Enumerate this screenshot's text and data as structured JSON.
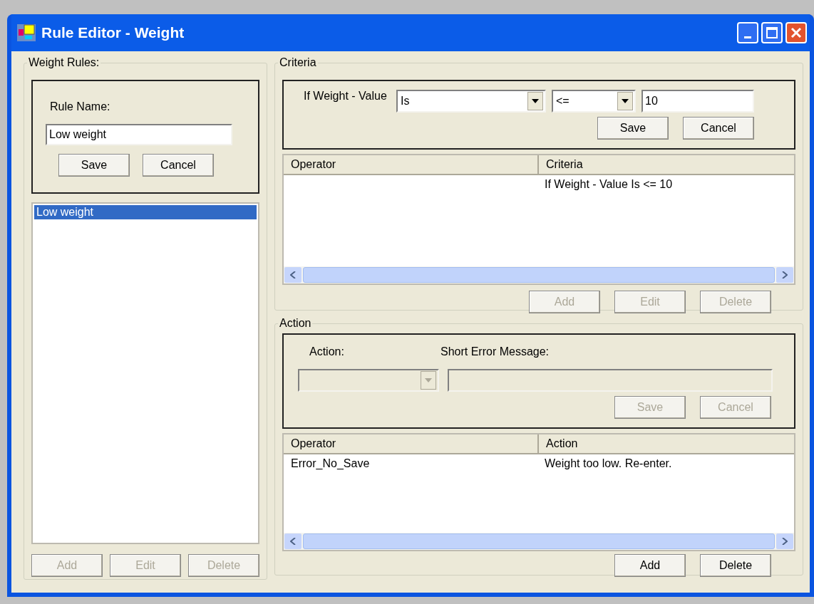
{
  "window": {
    "title": "Rule Editor - Weight"
  },
  "weight_rules": {
    "legend": "Weight Rules:",
    "rule_name_label": "Rule Name:",
    "rule_name_value": "Low weight",
    "form_buttons": [
      {
        "label": "Save",
        "disabled": false
      },
      {
        "label": "Cancel",
        "disabled": false
      }
    ],
    "list": [
      {
        "label": "Low weight",
        "selected": true
      }
    ],
    "list_buttons": [
      {
        "label": "Add",
        "disabled": true
      },
      {
        "label": "Edit",
        "disabled": true
      },
      {
        "label": "Delete",
        "disabled": true
      }
    ]
  },
  "criteria": {
    "legend": "Criteria",
    "field_label": "If Weight - Value",
    "condition_dropdown": {
      "value": "Is",
      "disabled": false
    },
    "operator_dropdown": {
      "value": "<=",
      "disabled": false
    },
    "value_field": {
      "value": "10",
      "disabled": false
    },
    "form_buttons": [
      {
        "label": "Save",
        "disabled": false
      },
      {
        "label": "Cancel",
        "disabled": false
      }
    ],
    "table": {
      "columns": [
        "Operator",
        "Criteria"
      ],
      "rows": [
        {
          "criteria": "If Weight - Value Is <= 10"
        }
      ]
    },
    "table_buttons": [
      {
        "label": "Add",
        "disabled": true
      },
      {
        "label": "Edit",
        "disabled": true
      },
      {
        "label": "Delete",
        "disabled": true
      }
    ]
  },
  "action": {
    "legend": "Action",
    "action_label": "Action:",
    "message_label": "Short Error Message:",
    "action_dropdown": {
      "disabled": true
    },
    "message_field": {
      "disabled": true
    },
    "form_buttons": [
      {
        "label": "Save",
        "disabled": true
      },
      {
        "label": "Cancel",
        "disabled": true
      }
    ],
    "table": {
      "columns": [
        "Operator",
        "Action"
      ],
      "rows": [
        {
          "operator": "Error_No_Save",
          "action": "Weight too low. Re-enter."
        }
      ]
    },
    "table_buttons": [
      {
        "label": "Add",
        "disabled": false
      },
      {
        "label": "Delete",
        "disabled": false
      }
    ]
  }
}
